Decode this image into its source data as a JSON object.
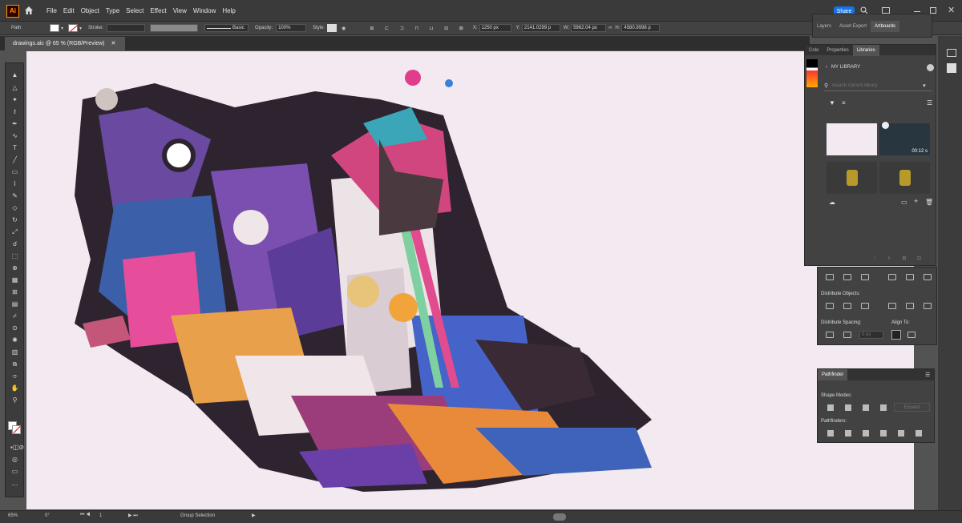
{
  "app": {
    "logo": "Ai"
  },
  "menu": [
    "File",
    "Edit",
    "Object",
    "Type",
    "Select",
    "Effect",
    "View",
    "Window",
    "Help"
  ],
  "share_label": "Share",
  "control": {
    "selection": "Path",
    "stroke_label": "Stroke:",
    "brush": "Basic",
    "opacity_label": "Opacity:",
    "opacity": "100%",
    "style_label": "Style:",
    "x_label": "X:",
    "x_value": "1250 px",
    "y_label": "Y:",
    "y_value": "2141.0299 p",
    "w_label": "W:",
    "w_value": "5962.04 px",
    "h_label": "H:",
    "h_value": "4580.9998 p"
  },
  "doc_tab": "drawings.aic @ 65 % (RGB/Preview)",
  "tools": [
    "selection-tool",
    "direct-selection-tool",
    "magic-wand-tool",
    "lasso-tool",
    "pen-tool",
    "curvature-tool",
    "type-tool",
    "line-tool",
    "rectangle-tool",
    "paintbrush-tool",
    "blob-brush-tool",
    "eraser-tool",
    "rotate-tool",
    "scale-tool",
    "warp-tool",
    "free-transform-tool",
    "shape-builder-tool",
    "perspective-grid-tool",
    "mesh-tool",
    "gradient-tool",
    "eyedropper-tool",
    "blend-tool",
    "symbol-sprayer-tool",
    "column-graph-tool",
    "artboard-tool",
    "slice-tool",
    "hand-tool",
    "zoom-tool"
  ],
  "top_panel_tabs": [
    "Layers",
    "Asset Export",
    "Artboards"
  ],
  "libraries": {
    "tabs": [
      "Colo",
      "Properties",
      "Libraries"
    ],
    "title": "MY LIBRARY",
    "search_placeholder": "Search current library",
    "video_time": "00:12 s"
  },
  "align": {
    "distribute_objects": "Distribute Objects:",
    "distribute_spacing": "Distribute Spacing:",
    "align_to": "Align To:",
    "spacing_value": "0 px"
  },
  "pathfinder": {
    "title": "Pathfinder",
    "shape_modes": "Shape Modes:",
    "pathfinders": "Pathfinders:",
    "expand": "Expand"
  },
  "status": {
    "zoom": "65%",
    "rotation": "0°",
    "artboard": "1",
    "tool_name": "Group Selection"
  }
}
